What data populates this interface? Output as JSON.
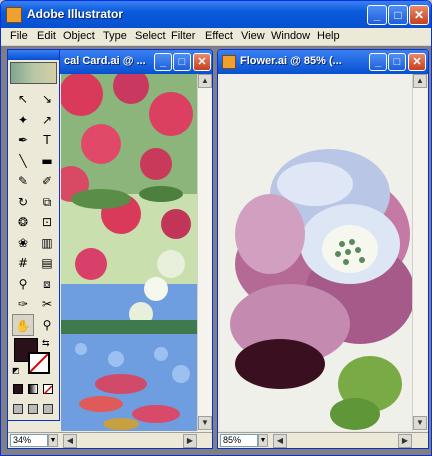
{
  "window": {
    "title": "Adobe Illustrator",
    "minimize": "_",
    "maximize": "□",
    "close": "✕"
  },
  "menu": [
    "File",
    "Edit",
    "Object",
    "Type",
    "Select",
    "Filter",
    "Effect",
    "View",
    "Window",
    "Help"
  ],
  "doc1": {
    "title": "cal Card.ai @ ...",
    "zoom": "34%",
    "min": "_",
    "max": "□",
    "close": "✕"
  },
  "doc2": {
    "title": "Flower.ai @ 85% (...",
    "zoom": "85%",
    "min": "_",
    "max": "□",
    "close": "✕"
  },
  "tools": {
    "items": [
      {
        "name": "selection-tool-icon",
        "glyph": "↖"
      },
      {
        "name": "direct-selection-tool-icon",
        "glyph": "↘"
      },
      {
        "name": "magic-wand-tool-icon",
        "glyph": "✦"
      },
      {
        "name": "lasso-tool-icon",
        "glyph": "↗"
      },
      {
        "name": "pen-tool-icon",
        "glyph": "✒"
      },
      {
        "name": "type-tool-icon",
        "glyph": "T"
      },
      {
        "name": "line-tool-icon",
        "glyph": "╲"
      },
      {
        "name": "rectangle-tool-icon",
        "glyph": "▬"
      },
      {
        "name": "paintbrush-tool-icon",
        "glyph": "✎"
      },
      {
        "name": "pencil-tool-icon",
        "glyph": "✐"
      },
      {
        "name": "rotate-tool-icon",
        "glyph": "↻"
      },
      {
        "name": "scale-tool-icon",
        "glyph": "⧉"
      },
      {
        "name": "warp-tool-icon",
        "glyph": "❂"
      },
      {
        "name": "free-transform-tool-icon",
        "glyph": "⊡"
      },
      {
        "name": "symbol-sprayer-tool-icon",
        "glyph": "❀"
      },
      {
        "name": "graph-tool-icon",
        "glyph": "▥"
      },
      {
        "name": "mesh-tool-icon",
        "glyph": "#"
      },
      {
        "name": "gradient-tool-icon",
        "glyph": "▤"
      },
      {
        "name": "eyedropper-tool-icon",
        "glyph": "⚲"
      },
      {
        "name": "blend-tool-icon",
        "glyph": "⧈"
      },
      {
        "name": "slice-tool-icon",
        "glyph": "✑"
      },
      {
        "name": "scissors-tool-icon",
        "glyph": "✂"
      },
      {
        "name": "hand-tool-icon",
        "glyph": "✋"
      },
      {
        "name": "zoom-tool-icon",
        "glyph": "⚲"
      }
    ]
  },
  "colors": {
    "fill": "#2a1018",
    "stroke": "#ffffff",
    "titlebar": "#0650d0",
    "accent": "#d93a5a"
  }
}
